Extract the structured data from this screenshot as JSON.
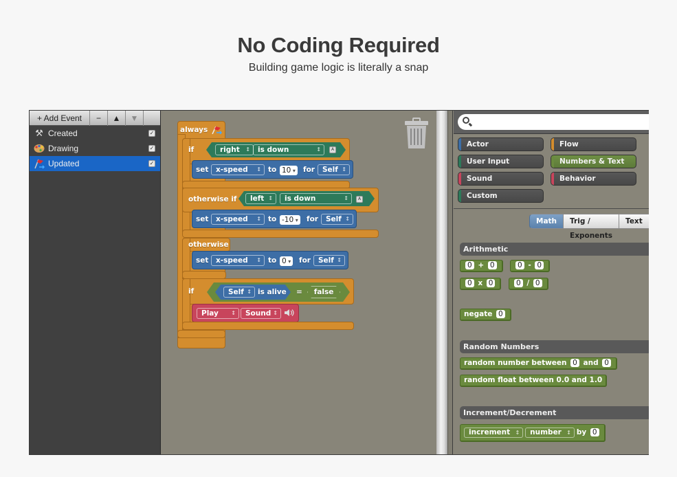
{
  "hero": {
    "title": "No Coding Required",
    "subtitle": "Building game logic is literally a snap"
  },
  "events": {
    "toolbar": {
      "add_label": "+ Add Event",
      "remove_label": "−",
      "up_label": "▲",
      "down_label": "▼"
    },
    "items": [
      {
        "label": "Created",
        "icon": "hammer-icon",
        "glyph": "⚒",
        "checked": true,
        "selected": false
      },
      {
        "label": "Drawing",
        "icon": "palette-icon",
        "glyph": "🎨",
        "checked": true,
        "selected": false
      },
      {
        "label": "Updated",
        "icon": "flag-icon",
        "glyph": "⚑",
        "checked": true,
        "selected": true
      }
    ]
  },
  "script": {
    "always_label": "always",
    "if1": {
      "label": "if",
      "key": "right",
      "state": "is down",
      "key_badge": "A"
    },
    "set1": {
      "label": "set",
      "attr": "x-speed",
      "to": "to",
      "value": "10",
      "for": "for",
      "target": "Self"
    },
    "elseif": {
      "label": "otherwise if",
      "key": "left",
      "state": "is down",
      "key_badge": "A"
    },
    "set2": {
      "label": "set",
      "attr": "x-speed",
      "to": "to",
      "value": "-10",
      "for": "for",
      "target": "Self"
    },
    "otherwise_label": "otherwise",
    "set3": {
      "label": "set",
      "attr": "x-speed",
      "to": "to",
      "value": "0",
      "for": "for",
      "target": "Self"
    },
    "if2": {
      "label": "if",
      "actor": "Self",
      "condition": "is alive",
      "op": "=",
      "value": "false"
    },
    "play": {
      "action": "Play",
      "kind": "Sound"
    }
  },
  "palette": {
    "search": {
      "value": "",
      "placeholder": ""
    },
    "categories": [
      {
        "label": "Actor",
        "color": "#3d6ea6",
        "active": false
      },
      {
        "label": "Flow",
        "color": "#d48d2e",
        "active": false
      },
      {
        "label": "User Input",
        "color": "#2d7a5a",
        "active": false
      },
      {
        "label": "Numbers & Text",
        "color": "#6a8a3e",
        "active": true
      },
      {
        "label": "Sound",
        "color": "#c8455c",
        "active": false
      },
      {
        "label": "Behavior",
        "color": "#c8455c",
        "active": false
      },
      {
        "label": "Custom",
        "color": "#2d7a5a",
        "active": false
      }
    ],
    "tabs": [
      {
        "label": "Math",
        "active": true
      },
      {
        "label": "Trig / Exponents",
        "active": false
      },
      {
        "label": "Text",
        "active": false
      }
    ],
    "sections": {
      "arithmetic": {
        "title": "Arithmetic",
        "add": {
          "a": "0",
          "op": "+",
          "b": "0"
        },
        "sub": {
          "a": "0",
          "op": "-",
          "b": "0"
        },
        "mul": {
          "a": "0",
          "op": "x",
          "b": "0"
        },
        "div": {
          "a": "0",
          "op": "/",
          "b": "0"
        },
        "negate": {
          "label": "negate",
          "value": "0"
        }
      },
      "random": {
        "title": "Random Numbers",
        "rand_int": {
          "label": "random number between",
          "a": "0",
          "and": "and",
          "b": "0"
        },
        "rand_float": {
          "label": "random float between 0.0 and 1.0"
        }
      },
      "increment": {
        "title": "Increment/Decrement",
        "mode": "increment",
        "target": "number",
        "by": "by",
        "value": "0"
      }
    }
  },
  "colors": {
    "flow": "#d48d2e",
    "actor": "#3d6ea6",
    "input": "#2d7a5a",
    "numbers": "#6a8a3e",
    "sound": "#c8455c",
    "selection": "#1a66c6"
  }
}
